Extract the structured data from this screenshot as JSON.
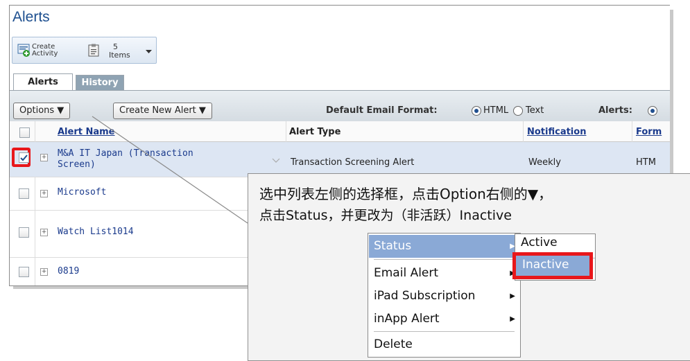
{
  "page": {
    "title": "Alerts"
  },
  "toolbar": {
    "create_line1": "Create",
    "create_line2": "Activity",
    "items_count": "5",
    "items_label": "Items"
  },
  "tabs": [
    {
      "label": "Alerts",
      "active": true
    },
    {
      "label": "History",
      "active": false
    }
  ],
  "grid_bar": {
    "options_label": "Options ▼",
    "create_alert_label": "Create New Alert ▼",
    "email_format_label": "Default Email Format:",
    "format_html": "HTML",
    "format_text": "Text",
    "alerts_label": "Alerts:"
  },
  "table": {
    "columns": [
      "Alert Name",
      "Alert Type",
      "Notification",
      "Form"
    ],
    "rows": [
      {
        "name_line1": "M&A IT Japan (Transaction",
        "name_line2": "Screen)",
        "type": "Transaction Screening Alert",
        "notification": "Weekly",
        "format": "HTM",
        "checked": true
      },
      {
        "name_line1": "Microsoft",
        "checked": false
      },
      {
        "name_line1": "Watch List1014",
        "checked": false
      },
      {
        "name_line1": "0819",
        "checked": false
      }
    ]
  },
  "callout": {
    "line1": "选中列表左侧的选择框，点击Option右侧的▼，",
    "line2": "点击Status，并更改为（非活跃）Inactive"
  },
  "menu": {
    "items": [
      "Status",
      "Email Alert",
      "iPad Subscription",
      "inApp Alert",
      "Delete"
    ],
    "submenu": [
      "Active",
      "Inactive"
    ]
  },
  "colors": {
    "title": "#1d4f8f",
    "link": "#1a3a8c",
    "highlight": "#e8171b",
    "menu_hover": "#8aa9d6"
  }
}
